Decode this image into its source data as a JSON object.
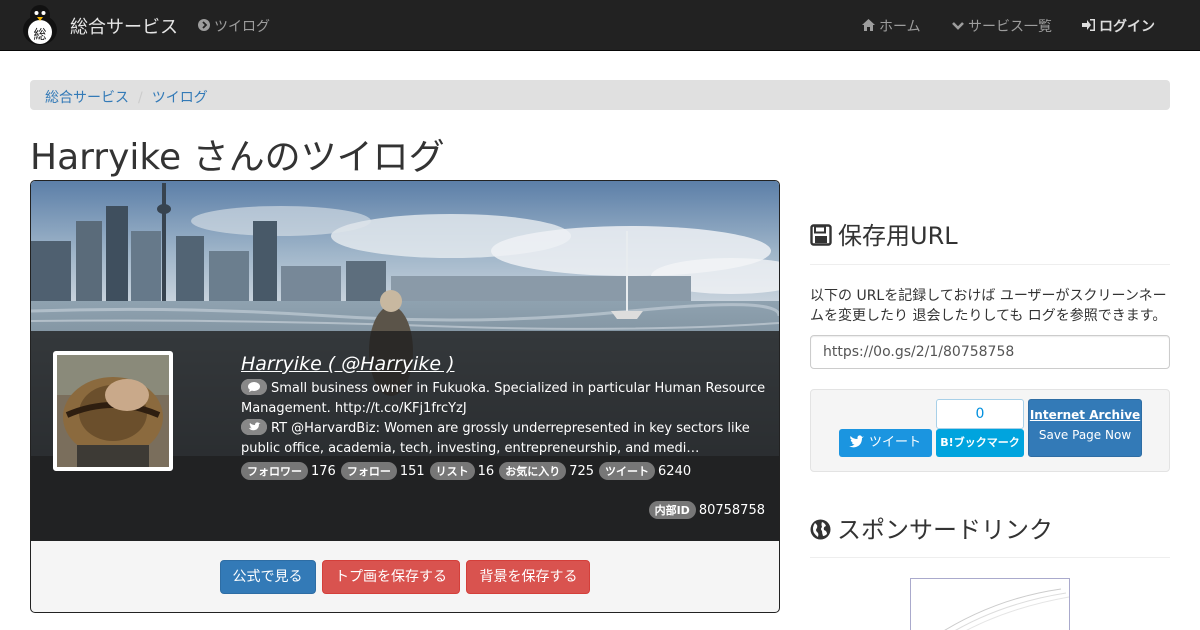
{
  "navbar": {
    "brand": "総合サービス",
    "logo_char": "総",
    "tweelog_link": "ツイログ",
    "home": "ホーム",
    "services": "サービス一覧",
    "login": "ログイン"
  },
  "breadcrumb": {
    "home": "総合サービス",
    "current": "ツイログ"
  },
  "page_title": "Harryike さんのツイログ",
  "profile": {
    "name": "Harryike ( @Harryike )",
    "bio": "Small business owner in Fukuoka. Specialized in particular Human Resource Management. http://t.co/KFj1frcYzJ",
    "latest_tweet": "RT @HarvardBiz: Women are grossly underrepresented in key sectors like public office, academia, tech, investing, entrepreneurship, and medi…",
    "stats": [
      {
        "label": "フォロワー",
        "value": "176"
      },
      {
        "label": "フォロー",
        "value": "151"
      },
      {
        "label": "リスト",
        "value": "16"
      },
      {
        "label": "お気に入り",
        "value": "725"
      },
      {
        "label": "ツイート",
        "value": "6240"
      }
    ],
    "internal_id_label": "内部ID",
    "internal_id": "80758758"
  },
  "buttons": {
    "official": "公式で見る",
    "save_icon": "トプ画を保存する",
    "save_bg": "背景を保存する"
  },
  "sidebar": {
    "save_url_title": "保存用URL",
    "description": "以下の URLを記録しておけば ユーザーがスクリーンネームを変更したり 退会したりしても ログを参照できます。",
    "url_value": "https://0o.gs/2/1/80758758",
    "tweet_button": "ツイート",
    "hatena_count": "0",
    "hatena_button": "B!ブックマーク",
    "ia_title": "Internet Archive",
    "ia_sub": "Save Page Now",
    "sponsored_title": "スポンサードリンク"
  },
  "colors": {
    "navbar_bg": "#222222",
    "link": "#337ab7",
    "primary": "#337ab7",
    "danger": "#d9534f",
    "twitter": "#1b95e0",
    "hatena": "#00a4de"
  },
  "icons": {
    "nav_tweelog": "chevron-circle-right-icon",
    "nav_home": "home-icon",
    "nav_services": "chevron-down-icon",
    "nav_login": "sign-in-icon",
    "save_url": "floppy-disk-icon",
    "sponsored": "globe-icon",
    "bio": "comment-icon",
    "tweet": "twitter-bird-icon"
  }
}
